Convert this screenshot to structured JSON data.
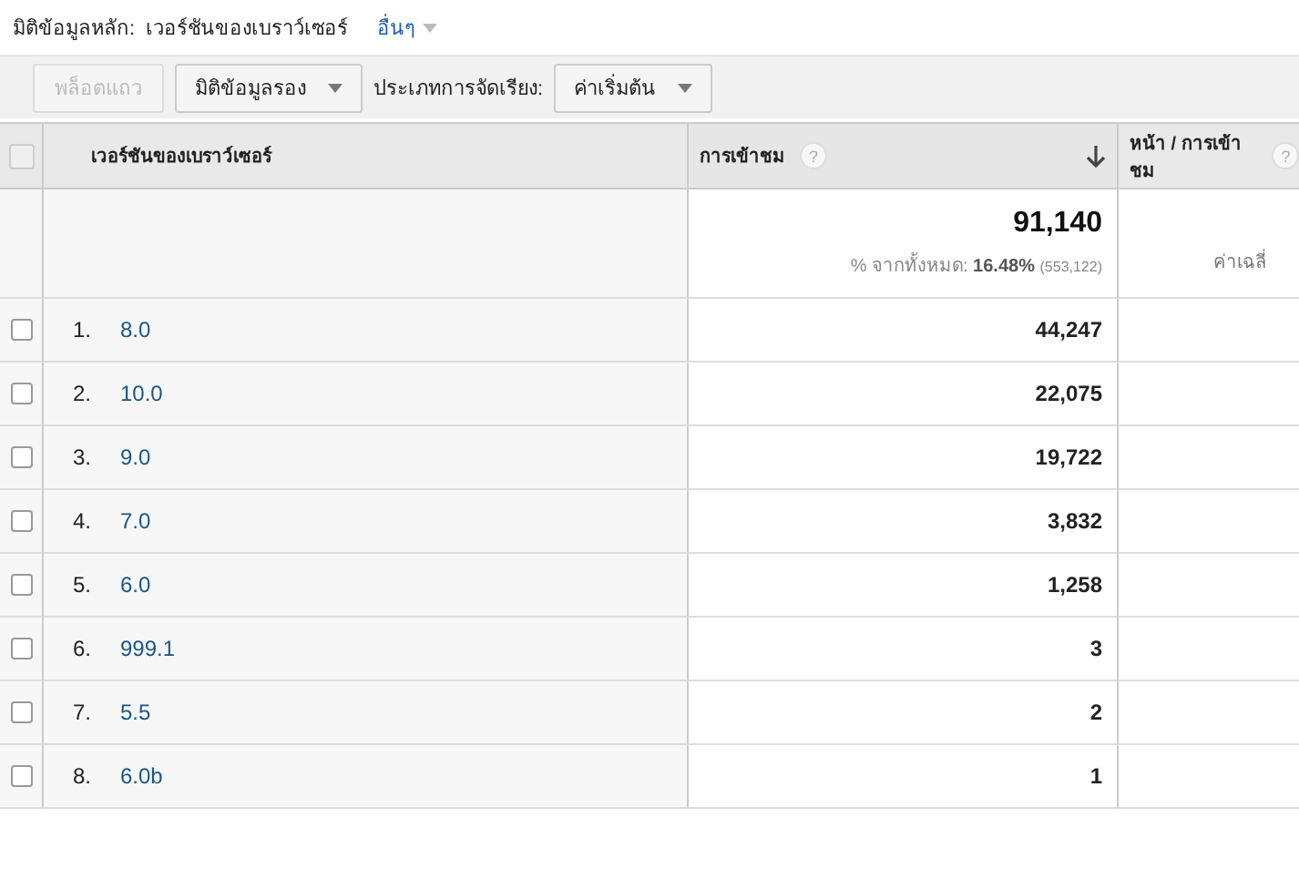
{
  "primary_dimension": {
    "label": "มิติข้อมูลหลัก:",
    "value": "เวอร์ชันของเบราว์เซอร์",
    "other": "อื่นๆ"
  },
  "toolbar": {
    "plot_button": {
      "label": "พล็อตแถว",
      "disabled": true
    },
    "secondary_dropdown": "มิติข้อมูลรอง",
    "sort_label": "ประเภทการจัดเรียง:",
    "sort_dropdown": "ค่าเริ่มต้น"
  },
  "table": {
    "select_all_checked": false,
    "columns": [
      {
        "label": "เวอร์ชันของเบราว์เซอร์",
        "sorted": false
      },
      {
        "label": "การเข้าชม",
        "help": "?",
        "sorted": true
      },
      {
        "label": "หน้า / การเข้าชม",
        "help": "?",
        "sorted": false
      }
    ],
    "summary": {
      "total": "91,140",
      "percent_label": "% จากทั้งหมด:",
      "percent": "16.48%",
      "overall": "(553,122)",
      "column_3": "ค่าเฉลี่"
    },
    "rows": [
      {
        "index": "1.",
        "version": "8.0",
        "visits": "44,247",
        "checked": false
      },
      {
        "index": "2.",
        "version": "10.0",
        "visits": "22,075",
        "checked": false
      },
      {
        "index": "3.",
        "version": "9.0",
        "visits": "19,722",
        "checked": false
      },
      {
        "index": "4.",
        "version": "7.0",
        "visits": "3,832",
        "checked": false
      },
      {
        "index": "5.",
        "version": "6.0",
        "visits": "1,258",
        "checked": false
      },
      {
        "index": "6.",
        "version": "999.1",
        "visits": "3",
        "checked": false
      },
      {
        "index": "7.",
        "version": "5.5",
        "visits": "2",
        "checked": false
      },
      {
        "index": "8.",
        "version": "6.0b",
        "visits": "1",
        "checked": false
      }
    ]
  }
}
